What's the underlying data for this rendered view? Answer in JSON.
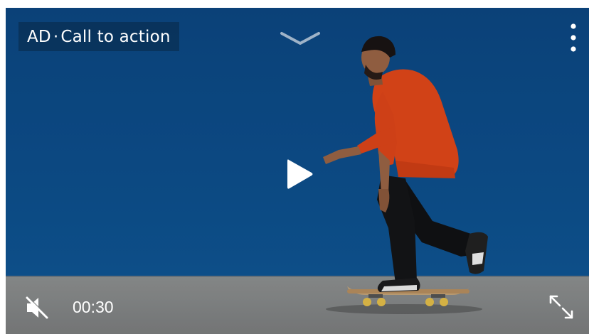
{
  "ad": {
    "badge": "AD",
    "separator": "·",
    "call_to_action": "Call to action"
  },
  "controls": {
    "time": "00:30",
    "icons": {
      "collapse": "chevron-down-icon",
      "more": "more-vertical-icon",
      "play": "play-icon",
      "mute": "muted-speaker-icon",
      "fullscreen": "expand-icon"
    }
  },
  "colors": {
    "wall": "#0d4a86",
    "ground": "#8a8c8c",
    "shirt": "#e3481a",
    "text": "#ffffff"
  }
}
